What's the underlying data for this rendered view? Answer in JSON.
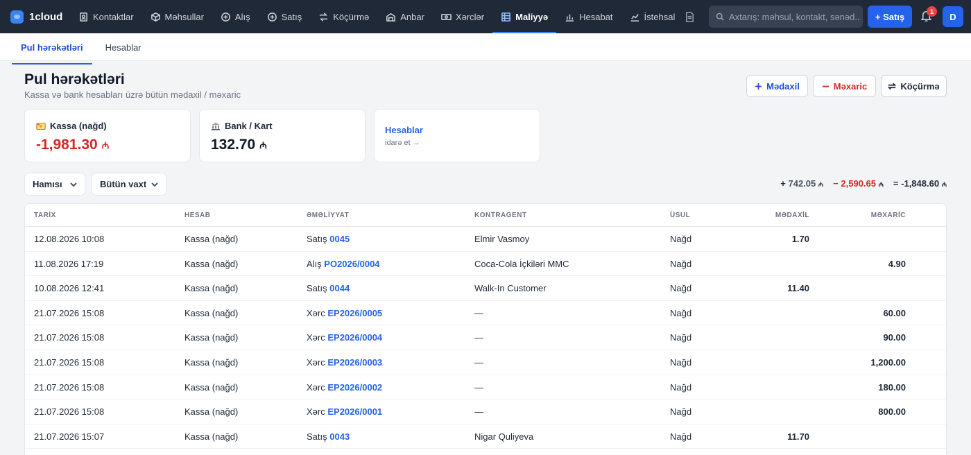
{
  "app": {
    "name": "1cloud"
  },
  "nav": {
    "items": [
      {
        "label": "Kontaktlar",
        "icon": "contacts-icon",
        "active": false
      },
      {
        "label": "Məhsullar",
        "icon": "box-icon",
        "active": false
      },
      {
        "label": "Alış",
        "icon": "plus-circle-icon",
        "active": false
      },
      {
        "label": "Satış",
        "icon": "plus-circle-icon",
        "active": false
      },
      {
        "label": "Köçürmə",
        "icon": "transfer-icon",
        "active": false
      },
      {
        "label": "Anbar",
        "icon": "warehouse-icon",
        "active": false
      },
      {
        "label": "Xərclər",
        "icon": "money-icon",
        "active": false
      },
      {
        "label": "Maliyyə",
        "icon": "grid-icon",
        "active": true
      },
      {
        "label": "Hesabat",
        "icon": "bar-chart-icon",
        "active": false
      },
      {
        "label": "İstehsal",
        "icon": "line-chart-icon",
        "active": false
      }
    ],
    "search_placeholder": "Axtarış: məhsul, kontakt, sənəd...",
    "sale_button": "+ Satış",
    "notification_count": "1",
    "avatar_initial": "D"
  },
  "subtabs": [
    {
      "label": "Pul hərəkətləri",
      "active": true
    },
    {
      "label": "Hesablar",
      "active": false
    }
  ],
  "header": {
    "title": "Pul hərəkətləri",
    "subtitle": "Kassa və bank hesabları üzrə bütün mədaxil / məxaric"
  },
  "actions": {
    "income": "Mədaxil",
    "expense": "Məxaric",
    "transfer": "Köçürmə"
  },
  "cards": {
    "cash": {
      "label": "Kassa (nağd)",
      "value": "-1,981.30",
      "currency": "₼",
      "color": "#dc2626"
    },
    "bank": {
      "label": "Bank / Kart",
      "value": "132.70",
      "currency": "₼",
      "color": "#111827"
    },
    "accounts": {
      "title": "Hesablar",
      "subtitle": "idarə et →"
    }
  },
  "filters": {
    "account": "Hamısı",
    "period": "Bütün vaxt"
  },
  "totals": {
    "income_sign": "+",
    "income": "742.05",
    "expense_sign": "−",
    "expense": "2,590.65",
    "net_sign": "=",
    "net": "-1,848.60",
    "currency": "₼"
  },
  "table": {
    "columns": [
      "TARİX",
      "HESAB",
      "ƏMƏLİYYAT",
      "KONTRAGENT",
      "ÜSUL",
      "MƏDAXİL",
      "MƏXARİC"
    ],
    "rows": [
      {
        "date": "12.08.2026 10:08",
        "account": "Kassa (nağd)",
        "op_type": "Satış",
        "doc": "0045",
        "counterparty": "Elmir Vasmoy",
        "method": "Nağd",
        "income": "1.70",
        "expense": ""
      },
      {
        "date": "11.08.2026 17:19",
        "account": "Kassa (nağd)",
        "op_type": "Alış",
        "doc": "PO2026/0004",
        "counterparty": "Coca-Cola İçkiləri MMC",
        "method": "Nağd",
        "income": "",
        "expense": "4.90"
      },
      {
        "date": "10.08.2026 12:41",
        "account": "Kassa (nağd)",
        "op_type": "Satış",
        "doc": "0044",
        "counterparty": "Walk-In Customer",
        "method": "Nağd",
        "income": "11.40",
        "expense": ""
      },
      {
        "date": "21.07.2026 15:08",
        "account": "Kassa (nağd)",
        "op_type": "Xərc",
        "doc": "EP2026/0005",
        "counterparty": "—",
        "method": "Nağd",
        "income": "",
        "expense": "60.00"
      },
      {
        "date": "21.07.2026 15:08",
        "account": "Kassa (nağd)",
        "op_type": "Xərc",
        "doc": "EP2026/0004",
        "counterparty": "—",
        "method": "Nağd",
        "income": "",
        "expense": "90.00"
      },
      {
        "date": "21.07.2026 15:08",
        "account": "Kassa (nağd)",
        "op_type": "Xərc",
        "doc": "EP2026/0003",
        "counterparty": "—",
        "method": "Nağd",
        "income": "",
        "expense": "1,200.00"
      },
      {
        "date": "21.07.2026 15:08",
        "account": "Kassa (nağd)",
        "op_type": "Xərc",
        "doc": "EP2026/0002",
        "counterparty": "—",
        "method": "Nağd",
        "income": "",
        "expense": "180.00"
      },
      {
        "date": "21.07.2026 15:08",
        "account": "Kassa (nağd)",
        "op_type": "Xərc",
        "doc": "EP2026/0001",
        "counterparty": "—",
        "method": "Nağd",
        "income": "",
        "expense": "800.00"
      },
      {
        "date": "21.07.2026 15:07",
        "account": "Kassa (nağd)",
        "op_type": "Satış",
        "doc": "0043",
        "counterparty": "Nigar Quliyeva",
        "method": "Nağd",
        "income": "11.70",
        "expense": ""
      }
    ]
  }
}
